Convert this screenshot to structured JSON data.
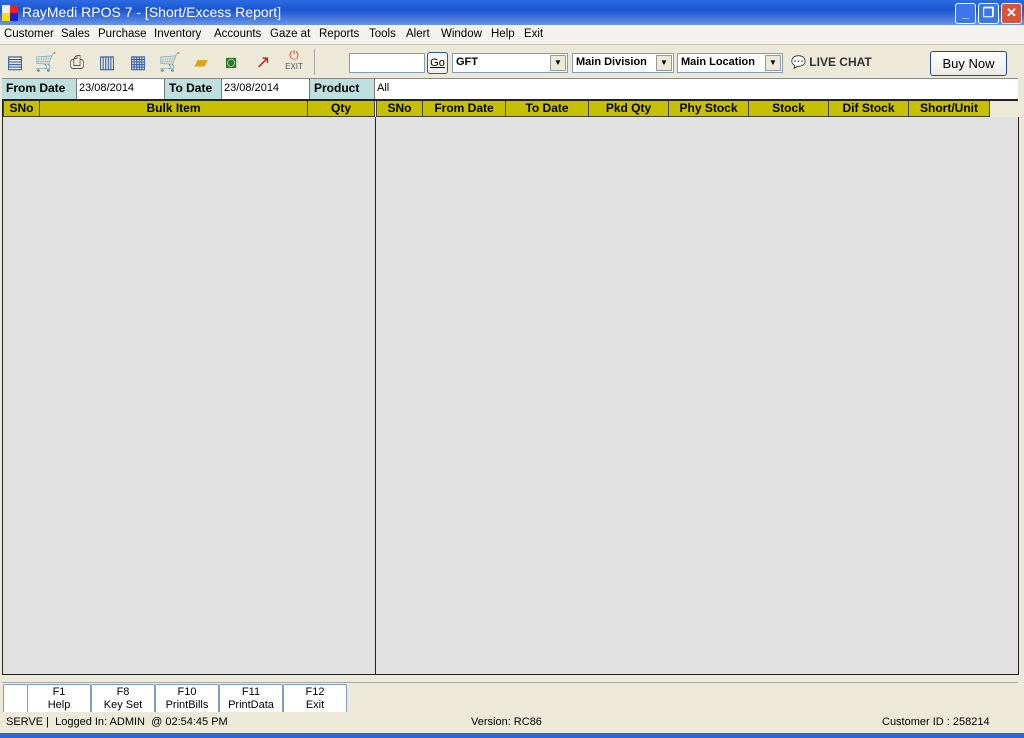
{
  "window": {
    "title": "RayMedi RPOS 7 - [Short/Excess Report]",
    "minimize": "_",
    "restore": "❐",
    "close": "✕"
  },
  "menu": [
    "Customer",
    "Sales",
    "Purchase",
    "Inventory",
    "Accounts",
    "Gaze at",
    "Reports",
    "Tools",
    "Alert",
    "Window",
    "Help",
    "Exit"
  ],
  "toolbar": {
    "icons": [
      "bill-icon",
      "purchase-cart-icon",
      "printer-icon",
      "barcode-icon",
      "document-icon",
      "cart-document-icon",
      "folder-icon",
      "users-icon",
      "chart-icon"
    ],
    "exit_label": "EXIT",
    "search_value": "",
    "go_label": "Go",
    "store_select": "GFT",
    "division_select": "Main Division",
    "location_select": "Main Location",
    "live_chat": "LIVE CHAT",
    "buy_now": "Buy Now"
  },
  "filter": {
    "from_label": "From Date",
    "from_value": "23/08/2014",
    "to_label": "To Date",
    "to_value": "23/08/2014",
    "product_label": "Product",
    "product_value": "All"
  },
  "left_table": {
    "headers": [
      "SNo",
      "Bulk Item",
      "Qty"
    ],
    "rows": []
  },
  "right_table": {
    "headers": [
      "SNo",
      "From Date",
      "To Date",
      "Pkd Qty",
      "Phy Stock",
      "Stock",
      "Dif Stock",
      "Short/Unit"
    ],
    "rows": []
  },
  "fkeys": [
    {
      "key": "F1",
      "label": "Help"
    },
    {
      "key": "F8",
      "label": "Key Set"
    },
    {
      "key": "F10",
      "label": "PrintBills"
    },
    {
      "key": "F11",
      "label": "PrintData"
    },
    {
      "key": "F12",
      "label": "Exit"
    }
  ],
  "status": {
    "left": "SERVE |  Logged In: ADMIN  @ 02:54:45 PM",
    "version": "Version: RC86",
    "customer": "Customer ID : 258214"
  }
}
